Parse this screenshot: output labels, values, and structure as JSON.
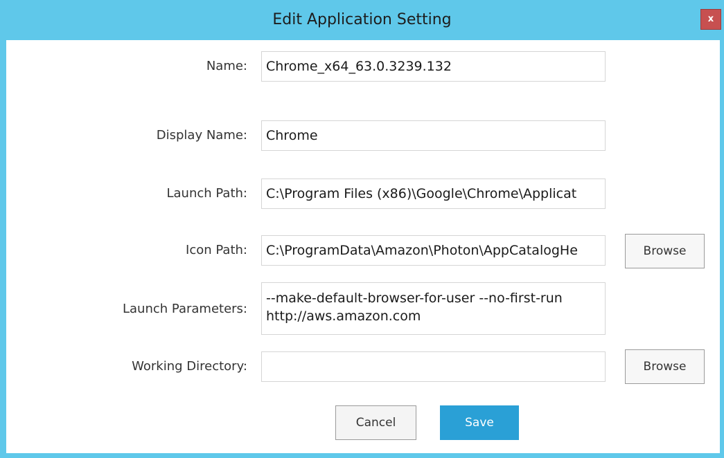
{
  "dialog": {
    "title": "Edit Application Setting",
    "close_label": "x"
  },
  "form": {
    "name": {
      "label": "Name:",
      "value": "Chrome_x64_63.0.3239.132"
    },
    "display_name": {
      "label": "Display Name:",
      "value": "Chrome"
    },
    "launch_path": {
      "label": "Launch Path:",
      "value": "C:\\Program Files (x86)\\Google\\Chrome\\Applicat"
    },
    "icon_path": {
      "label": "Icon Path:",
      "value": "C:\\ProgramData\\Amazon\\Photon\\AppCatalogHe"
    },
    "launch_parameters": {
      "label": "Launch Parameters:",
      "value": "--make-default-browser-for-user --no-first-run http://aws.amazon.com"
    },
    "working_directory": {
      "label": "Working Directory:",
      "value": ""
    }
  },
  "buttons": {
    "browse_icon": "Browse",
    "browse_working_dir": "Browse",
    "cancel": "Cancel",
    "save": "Save"
  },
  "colors": {
    "titlebar": "#5fc8ea",
    "close": "#c75050",
    "save": "#2aa0d6"
  }
}
